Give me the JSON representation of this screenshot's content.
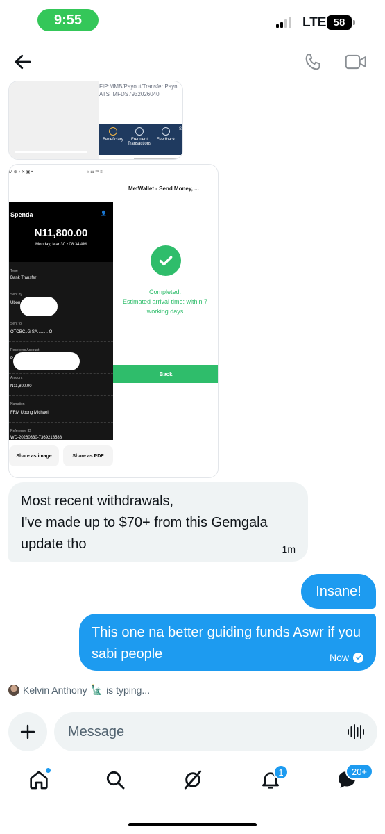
{
  "status_bar": {
    "time": "9:55",
    "network": "LTE",
    "battery": "58"
  },
  "header": {
    "back_icon": "back-arrow-icon",
    "call_icon": "phone-icon",
    "video_icon": "video-icon"
  },
  "media1": {
    "reference_text": "FIP:MMB/Payout/Transfer Payn\nATS_MFDS7932026040",
    "nav": [
      "Beneficiary",
      "Frequent Transactions",
      "Feedback",
      "S"
    ]
  },
  "media2": {
    "status_left": "M ⊕ ♪ ✕ ▣ •",
    "status_right": "⌂ ☷ ⁸⁸ ≡",
    "app_title": "MetWallet - Send Money, ...",
    "receipt": {
      "brand": "Spenda",
      "amount": "N11,800.00",
      "date": "Monday, Mar 30  •  08:34 AM",
      "rows": [
        {
          "label": "Type",
          "value": "Bank Transfer"
        },
        {
          "label": "Sent by",
          "value": "Ubon"
        },
        {
          "label": "Sent to",
          "value": "OTOBC..G SA......... O"
        },
        {
          "label": "Receivers Account",
          "value": "P"
        },
        {
          "label": "Amount",
          "value": "N11,800.00"
        },
        {
          "label": "Narration",
          "value": "FRM Ubong Michael"
        },
        {
          "label": "Reference ID",
          "value": "WD-20260330-7369218588"
        }
      ],
      "share_image": "Share as image",
      "share_pdf": "Share as PDF"
    },
    "completed": "Completed.\nEstimated arrival time:  within 7\nworking days",
    "back_button": "Back"
  },
  "messages": {
    "received": {
      "text": "Most recent withdrawals,\nI've made up to $70+ from this Gemgala\nupdate tho",
      "time": "1m"
    },
    "sent1": {
      "text": "Insane!"
    },
    "sent2": {
      "text": "This one na better guiding funds Aswr if you sabi people",
      "time": "Now"
    }
  },
  "typing": {
    "name": "Kelvin Anthony",
    "emoji": "🗽",
    "suffix": "is typing..."
  },
  "composer": {
    "placeholder": "Message"
  },
  "bottom_nav": {
    "notifications_badge": "1",
    "messages_badge": "20+"
  },
  "colors": {
    "accent": "#1d9bf0",
    "success": "#2fbd6b",
    "bubble_in": "#eff3f4",
    "status_pill": "#34c759"
  }
}
